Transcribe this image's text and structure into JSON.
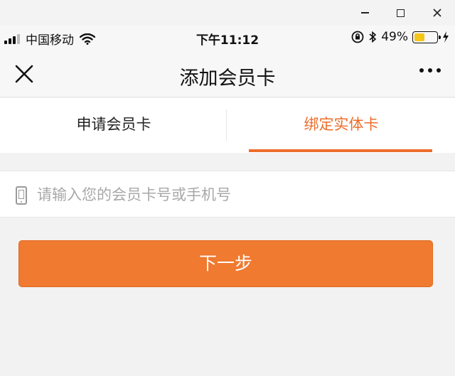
{
  "window": {
    "minimize_icon": "minimize-icon",
    "maximize_icon": "maximize-icon",
    "close_icon": "close-icon"
  },
  "statusbar": {
    "carrier": "中国移动",
    "time": "下午11:12",
    "battery_percent": "49%",
    "battery_level": 0.49
  },
  "navbar": {
    "title": "添加会员卡"
  },
  "tabs": [
    {
      "label": "申请会员卡",
      "active": false
    },
    {
      "label": "绑定实体卡",
      "active": true
    }
  ],
  "form": {
    "card_placeholder": "请输入您的会员卡号或手机号",
    "card_value": "",
    "next_label": "下一步"
  },
  "colors": {
    "accent": "#ec6d2b",
    "button": "#ef7a30",
    "battery": "#f5c518"
  }
}
